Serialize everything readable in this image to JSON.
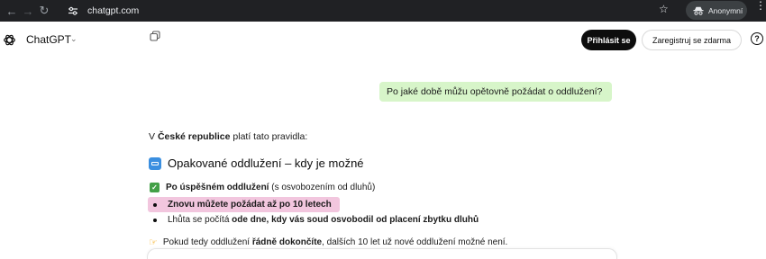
{
  "browser": {
    "url": "chatgpt.com",
    "profile_label": "Anonymní"
  },
  "app": {
    "title": "ChatGPT",
    "login_label": "Přihlásit se",
    "signup_label": "Zaregistruj se zdarma",
    "help_label": "?"
  },
  "conversation": {
    "user_message": "Po jaké době můžu opětovně požádat o oddlužení?",
    "intro_bold": "České republice",
    "intro_prefix": "V",
    "intro_suffix": "platí tato pravidla:",
    "heading": "Opakované oddlužení – kdy je možné",
    "check_item_bold": "Po úspěšném oddlužení",
    "check_item_rest": "(s osvobozením od dluhů)",
    "highlight_item": "Znovu můžete požádat až po 10 letech",
    "bullet_prefix": "Lhůta se počítá",
    "bullet_bold": "ode dne, kdy vás soud osvobodil od placení zbytku dluhů",
    "point_prefix": "Pokud tedy oddlužení",
    "point_bold": "řádně dokončíte",
    "point_suffix": ", dalších 10 let už nové oddlužení možné není."
  },
  "colors": {
    "chrome_bg": "#202124",
    "user_bubble_bg": "#d7f5c9",
    "highlight_bg": "#f2c6de",
    "login_bg": "#0d0d0d",
    "check_green": "#43a047",
    "heading_icon_blue": "#3b8fe0"
  },
  "icons": {
    "back": "arrow-left-icon",
    "forward": "arrow-right-icon",
    "reload": "reload-icon",
    "site_info": "tune-icon",
    "bookmark": "star-icon",
    "incognito": "incognito-icon",
    "menu": "more-vert-icon",
    "logo": "openai-logo-icon",
    "new_chat": "copy-icon",
    "help": "help-icon",
    "heading": "window-icon",
    "check": "check-mark-icon",
    "point": "pointing-hand-icon"
  }
}
